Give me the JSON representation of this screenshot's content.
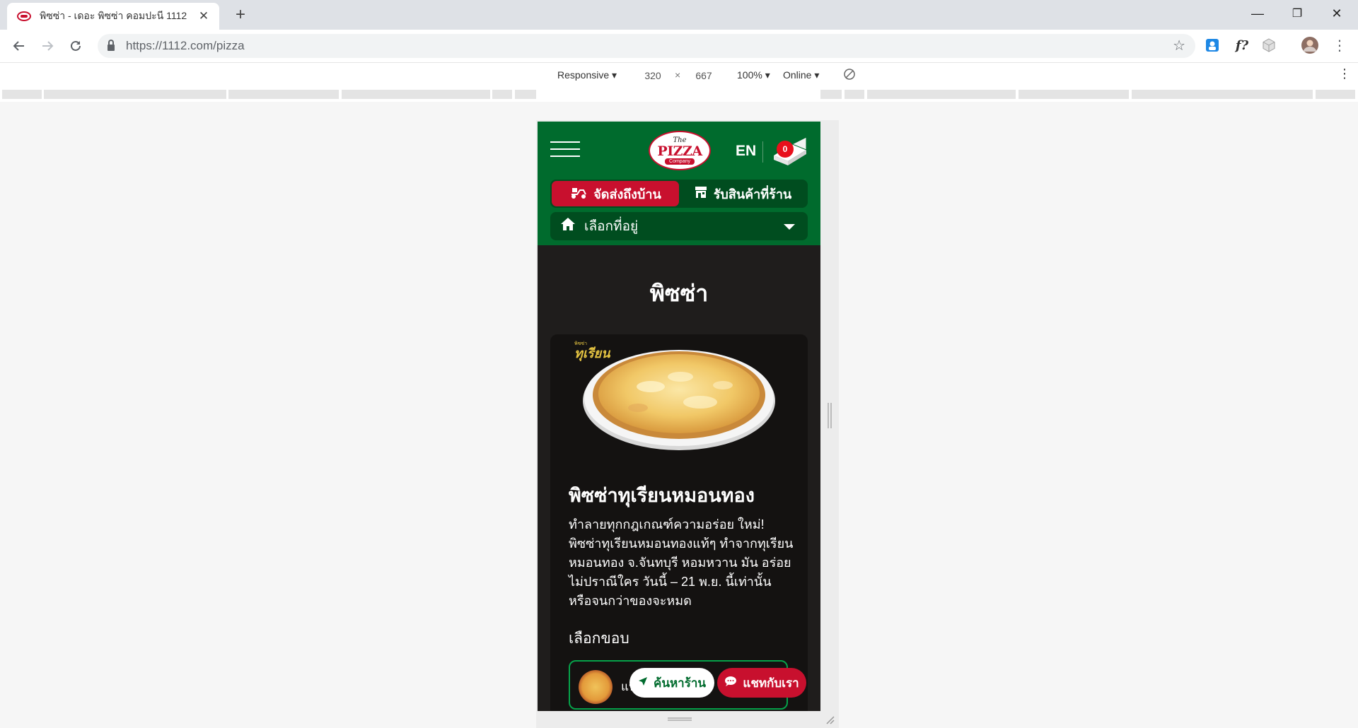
{
  "browser": {
    "tab_title": "พิซซ่า - เดอะ พิซซ่า คอมปะนี 1112",
    "tab_close": "✕",
    "new_tab": "+",
    "url": "https://1112.com/pizza",
    "window_controls": [
      "—",
      "❐",
      "✕"
    ]
  },
  "devtools": {
    "device": "Responsive ▾",
    "width": "320",
    "times": "×",
    "height": "667",
    "zoom": "100% ▾",
    "network": "Online ▾"
  },
  "site": {
    "logo_the": "The",
    "logo_main": "PIZZA",
    "logo_company": "Company",
    "language": "EN",
    "cart_count": "0",
    "modes": {
      "delivery": "จัดส่งถึงบ้าน",
      "pickup": "รับสินค้าที่ร้าน"
    },
    "address_placeholder": "เลือกที่อยู่",
    "page_title": "พิซซ่า",
    "product": {
      "badge_top": "พิซซ่า",
      "badge_main": "ทุเรียน",
      "title": "พิซซ่าทุเรียนหมอนทอง",
      "description": "ทำลายทุกกฎเกณฑ์ความอร่อย ใหม่! พิซซ่าทุเรียนหมอนทองแท้ๆ ทำจากทุเรียนหมอนทอง จ.จันทบุรี หอมหวาน มัน อร่อยไม่ปราณีใคร วันนี้ – 21 พ.ย. นี้เท่านั้น หรือจนกว่าของจะหมด",
      "crust_label": "เลือกขอบ",
      "crust_option_text": "แป้งหนานุ่ม"
    },
    "find_store": "ค้นหาร้าน",
    "chat": "แชทกับเรา"
  },
  "colors": {
    "header_green": "#006b2d",
    "dark_green": "#004d1f",
    "brand_red": "#c8102e",
    "card_bg": "#141211"
  }
}
